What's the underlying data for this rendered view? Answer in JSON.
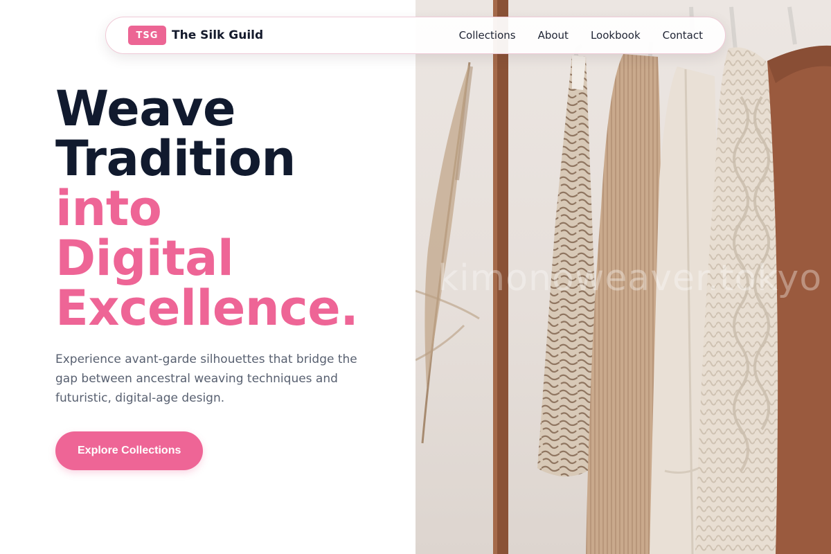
{
  "brand": {
    "badge": "TSG",
    "name": "The Silk Guild"
  },
  "nav": {
    "links": [
      "Collections",
      "About",
      "Lookbook",
      "Contact"
    ]
  },
  "hero": {
    "headline_lines_dark": [
      "Weave",
      "Tradition"
    ],
    "headline_lines_accent": [
      "into",
      "Digital",
      "Excellence."
    ],
    "subtext": "Experience avant-garde silhouettes that bridge the gap between ancestral weaving techniques and futuristic, digital-age design.",
    "cta_label": "Explore Collections"
  },
  "photo": {
    "watermark": "kimonoweaver.tokyo",
    "subject": "clothing rack with knit sweaters and dried pampas grass"
  },
  "colors": {
    "accent": "#ee6596",
    "heading": "#111a2e",
    "body_text": "#586070"
  }
}
